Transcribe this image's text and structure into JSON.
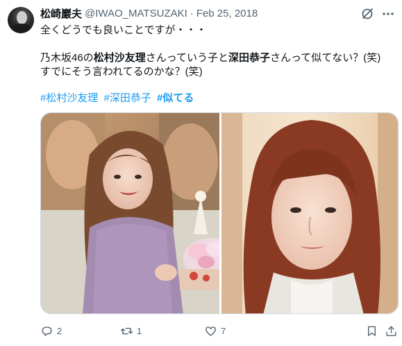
{
  "tweet": {
    "author_name": "松崎巖夫",
    "handle": "@IWAO_MATSUZAKI",
    "separator": "·",
    "date": "Feb 25, 2018",
    "line1": "全くどうでも良いことですが・・・",
    "line3_prefix": "乃木坂46の",
    "line3_name1": "松村沙友理",
    "line3_mid": "さんっていう子と",
    "line3_name2": "深田恭子",
    "line3_suffix": "さんって似てない？(笑)",
    "line4": "すでにそう言われてるのかな？(笑)",
    "hashtags": [
      "#松村沙友理",
      "#深田恭子",
      "#似てる"
    ]
  },
  "actions": {
    "reply_count": "2",
    "retweet_count": "1",
    "like_count": "7"
  },
  "icons": {
    "grok": "grok-icon",
    "more": "more-icon",
    "reply": "reply-icon",
    "retweet": "retweet-icon",
    "like": "like-icon",
    "bookmark": "bookmark-icon",
    "share": "share-icon"
  },
  "colors": {
    "link": "#1d9bf0",
    "secondary_text": "#536471",
    "primary_text": "#0f1419"
  }
}
